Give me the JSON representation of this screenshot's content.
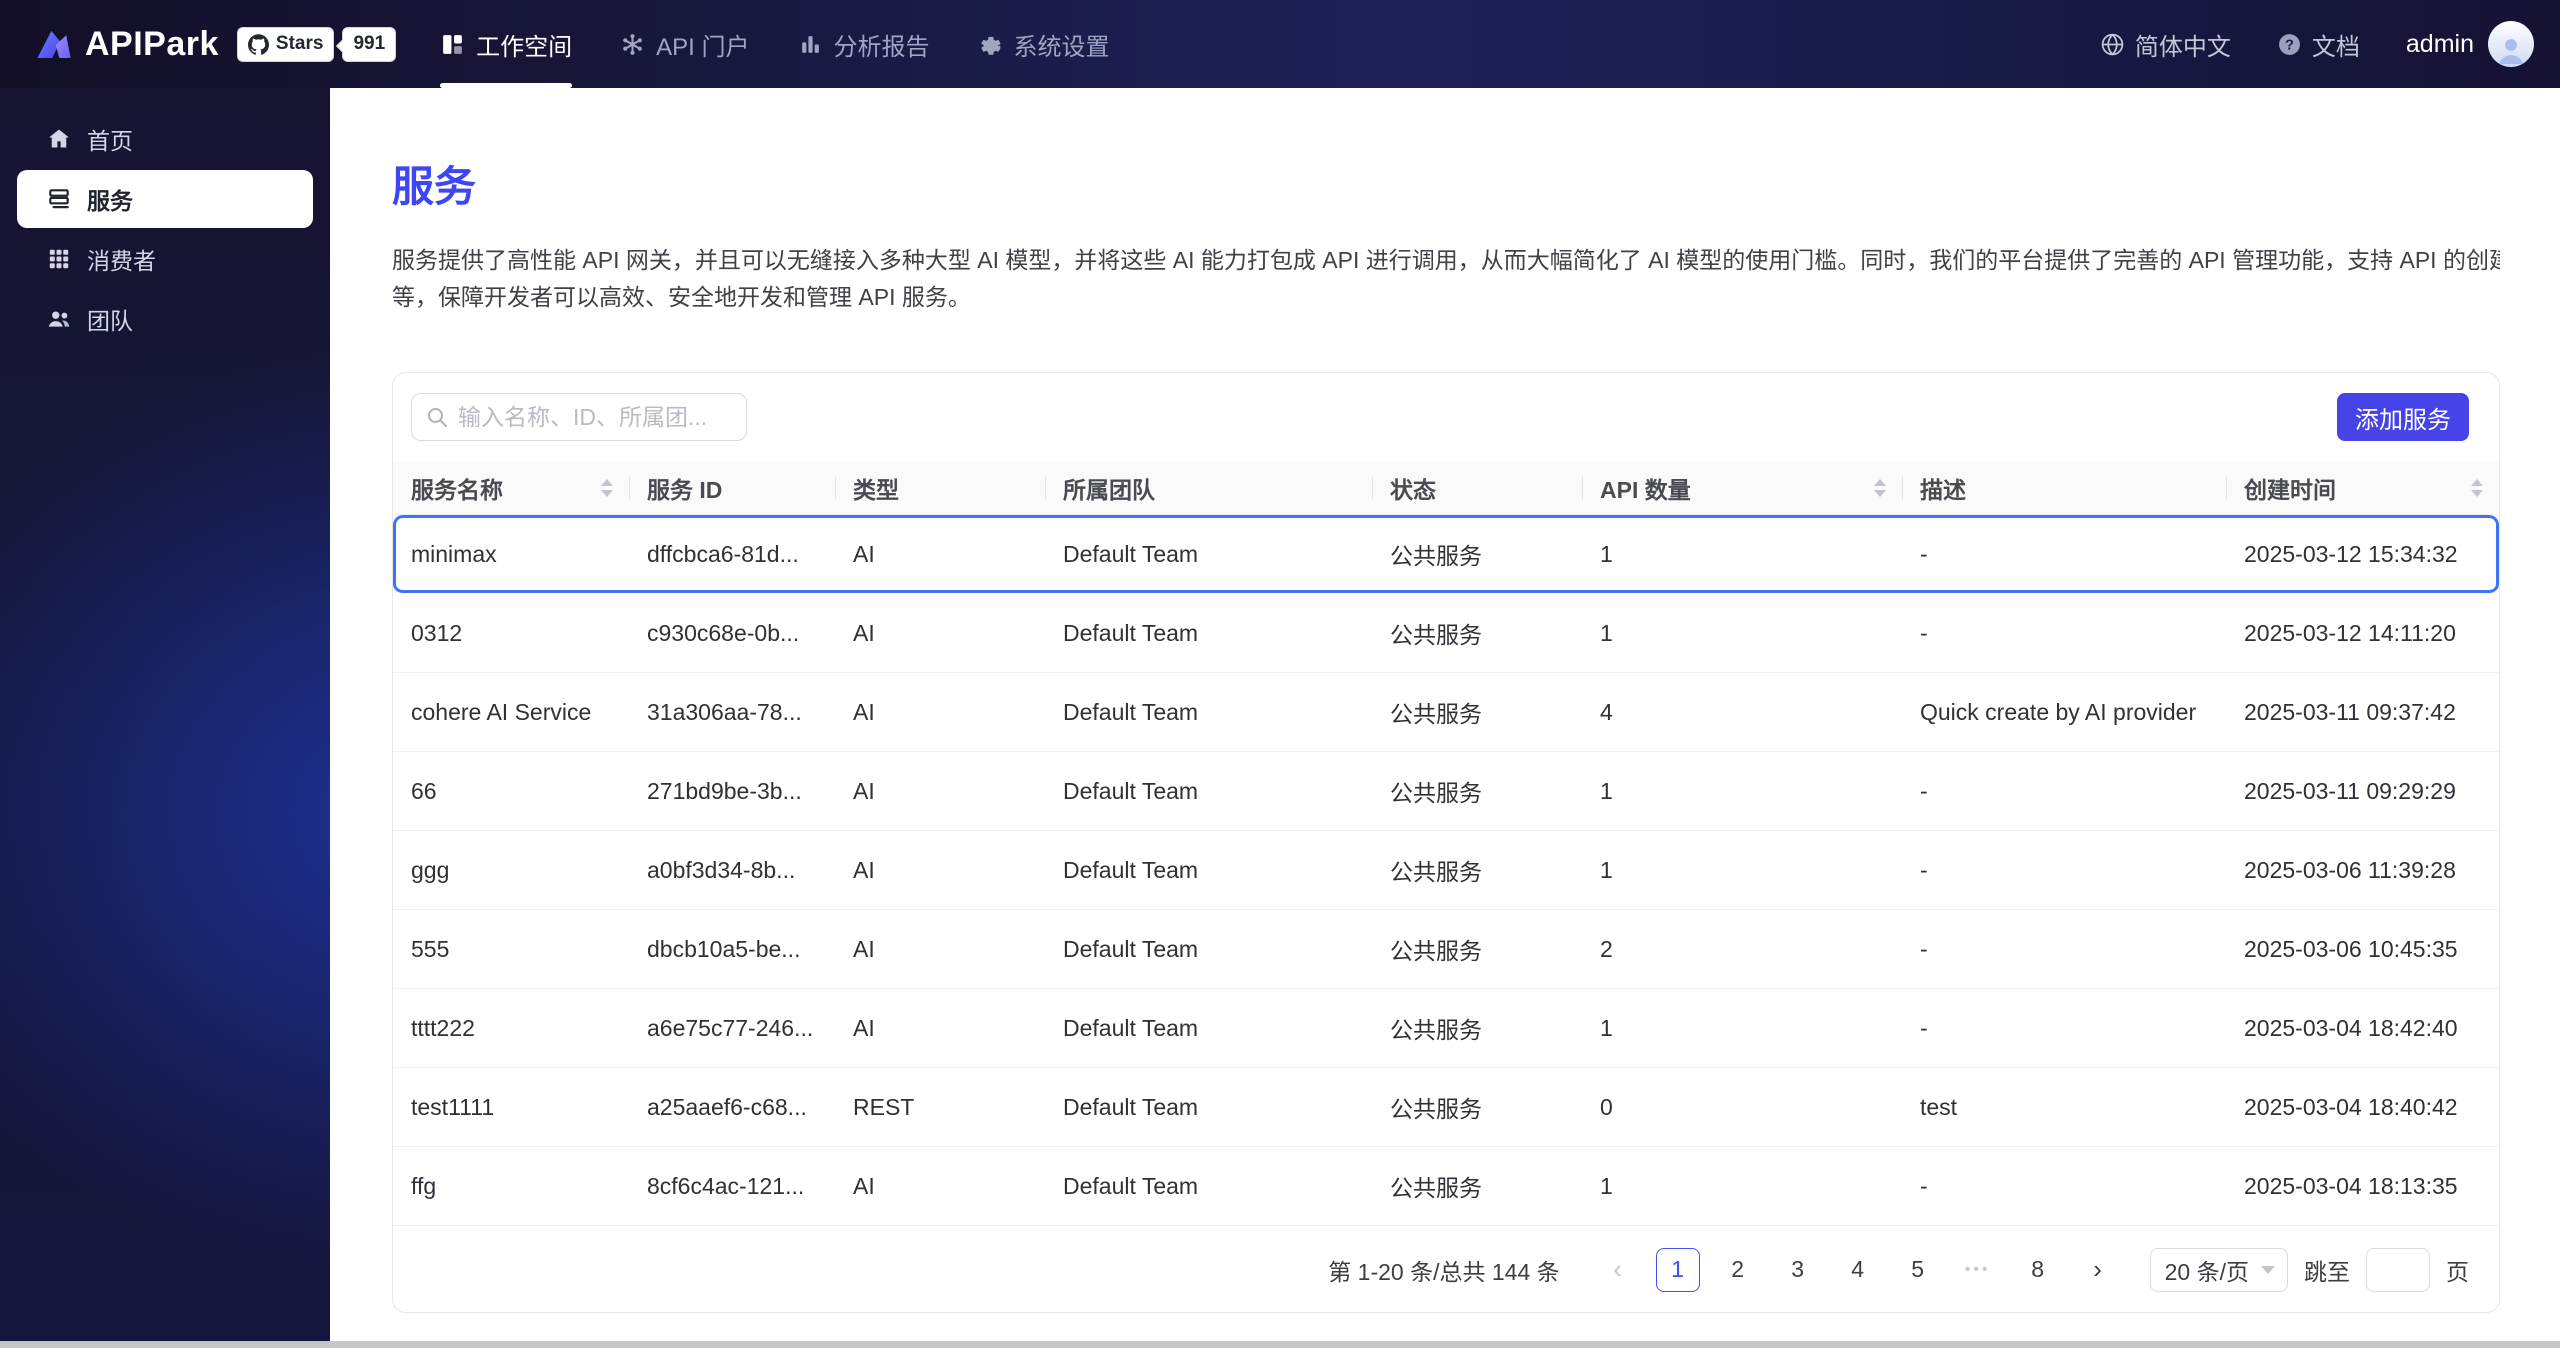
{
  "colors": {
    "brand_blue": "#3d46f2",
    "button_blue": "#4643e9",
    "selected_row_border": "#3d73f5",
    "navbar_bg": "#171638",
    "sidebar_bg": "#141637"
  },
  "navbar": {
    "brand": "APIPark",
    "github": {
      "stars_label": "Stars",
      "count": "991"
    },
    "items": [
      {
        "label": "工作空间",
        "icon": "workspace",
        "active": true
      },
      {
        "label": "API 门户",
        "icon": "portal",
        "active": false
      },
      {
        "label": "分析报告",
        "icon": "analytics",
        "active": false
      },
      {
        "label": "系统设置",
        "icon": "settings",
        "active": false
      }
    ],
    "language": "简体中文",
    "docs": "文档",
    "user": "admin"
  },
  "sidebar": {
    "items": [
      {
        "label": "首页",
        "icon": "home",
        "active": false
      },
      {
        "label": "服务",
        "icon": "services",
        "active": true
      },
      {
        "label": "消费者",
        "icon": "consumers",
        "active": false
      },
      {
        "label": "团队",
        "icon": "teams",
        "active": false
      }
    ]
  },
  "page": {
    "title": "服务",
    "description_line1": "服务提供了高性能 API 网关，并且可以无缝接入多种大型 AI 模型，并将这些 AI 能力打包成 API 进行调用，从而大幅简化了 AI 模型的使用门槛。同时，我们的平台提供了完善的 API 管理功能，支持 API 的创建、监控、访问控制",
    "description_line2": "等，保障开发者可以高效、安全地开发和管理 API 服务。"
  },
  "toolbar": {
    "search_placeholder": "输入名称、ID、所属团...",
    "add_button": "添加服务"
  },
  "table": {
    "columns": [
      {
        "label": "服务名称",
        "sortable": true
      },
      {
        "label": "服务 ID",
        "sortable": false
      },
      {
        "label": "类型",
        "sortable": false
      },
      {
        "label": "所属团队",
        "sortable": false
      },
      {
        "label": "状态",
        "sortable": false
      },
      {
        "label": "API 数量",
        "sortable": true
      },
      {
        "label": "描述",
        "sortable": false
      },
      {
        "label": "创建时间",
        "sortable": true
      }
    ],
    "rows": [
      {
        "name": "minimax",
        "id": "dffcbca6-81d...",
        "type": "AI",
        "team": "Default Team",
        "status": "公共服务",
        "api_count": "1",
        "desc": "-",
        "created": "2025-03-12 15:34:32",
        "selected": true
      },
      {
        "name": "0312",
        "id": "c930c68e-0b...",
        "type": "AI",
        "team": "Default Team",
        "status": "公共服务",
        "api_count": "1",
        "desc": "-",
        "created": "2025-03-12 14:11:20",
        "selected": false
      },
      {
        "name": "cohere AI Service",
        "id": "31a306aa-78...",
        "type": "AI",
        "team": "Default Team",
        "status": "公共服务",
        "api_count": "4",
        "desc": "Quick create by AI provider",
        "created": "2025-03-11 09:37:42",
        "selected": false
      },
      {
        "name": "66",
        "id": "271bd9be-3b...",
        "type": "AI",
        "team": "Default Team",
        "status": "公共服务",
        "api_count": "1",
        "desc": "-",
        "created": "2025-03-11 09:29:29",
        "selected": false
      },
      {
        "name": "ggg",
        "id": "a0bf3d34-8b...",
        "type": "AI",
        "team": "Default Team",
        "status": "公共服务",
        "api_count": "1",
        "desc": "-",
        "created": "2025-03-06 11:39:28",
        "selected": false
      },
      {
        "name": "555",
        "id": "dbcb10a5-be...",
        "type": "AI",
        "team": "Default Team",
        "status": "公共服务",
        "api_count": "2",
        "desc": "-",
        "created": "2025-03-06 10:45:35",
        "selected": false
      },
      {
        "name": "tttt222",
        "id": "a6e75c77-246...",
        "type": "AI",
        "team": "Default Team",
        "status": "公共服务",
        "api_count": "1",
        "desc": "-",
        "created": "2025-03-04 18:42:40",
        "selected": false
      },
      {
        "name": "test1111",
        "id": "a25aaef6-c68...",
        "type": "REST",
        "team": "Default Team",
        "status": "公共服务",
        "api_count": "0",
        "desc": "test",
        "created": "2025-03-04 18:40:42",
        "selected": false
      },
      {
        "name": "ffg",
        "id": "8cf6c4ac-121...",
        "type": "AI",
        "team": "Default Team",
        "status": "公共服务",
        "api_count": "1",
        "desc": "-",
        "created": "2025-03-04 18:13:35",
        "selected": false
      }
    ]
  },
  "pagination": {
    "total_text": "第 1-20 条/总共 144 条",
    "pages": [
      {
        "label": "1",
        "current": true,
        "dots": false
      },
      {
        "label": "2",
        "current": false,
        "dots": false
      },
      {
        "label": "3",
        "current": false,
        "dots": false
      },
      {
        "label": "4",
        "current": false,
        "dots": false
      },
      {
        "label": "5",
        "current": false,
        "dots": false
      },
      {
        "label": "•••",
        "current": false,
        "dots": true
      },
      {
        "label": "8",
        "current": false,
        "dots": false
      }
    ],
    "prev": "‹",
    "next": "›",
    "page_size": "20 条/页",
    "jump_label": "跳至",
    "page_label": "页"
  }
}
